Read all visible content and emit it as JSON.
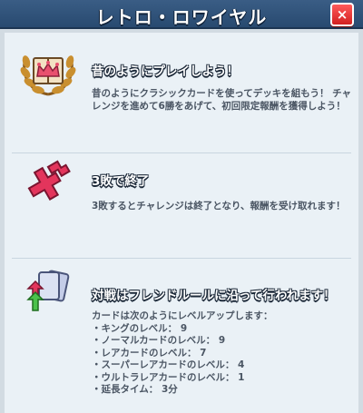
{
  "header": {
    "title": "レトロ・ロワイヤル",
    "close_label": "×"
  },
  "sections": [
    {
      "heading": "昔のようにプレイしよう！",
      "description": "昔のようにクラシックカードを使ってデッキを組もう！ チャレンジを進めて6勝をあげて、初回限定報酬を獲得しよう！",
      "icon": "book-crown-laurel-icon"
    },
    {
      "heading": "3敗で終了",
      "description": "3敗するとチャレンジは終了となり、報酬を受け取れます！",
      "icon": "broken-red-cross-icon"
    },
    {
      "heading": "対戦はフレンドルールに沿って行われます！",
      "rules_intro": "カードは次のようにレベルアップします：",
      "rules": [
        "・キングのレベル： 9",
        "・ノーマルカードのレベル： 9",
        "・レアカードのレベル： 7",
        "・スーパーレアカードのレベル： 4",
        "・ウルトラレアカードのレベル： 1",
        "・延長タイム： 3分"
      ],
      "icon": "cards-arrows-icon"
    }
  ]
}
